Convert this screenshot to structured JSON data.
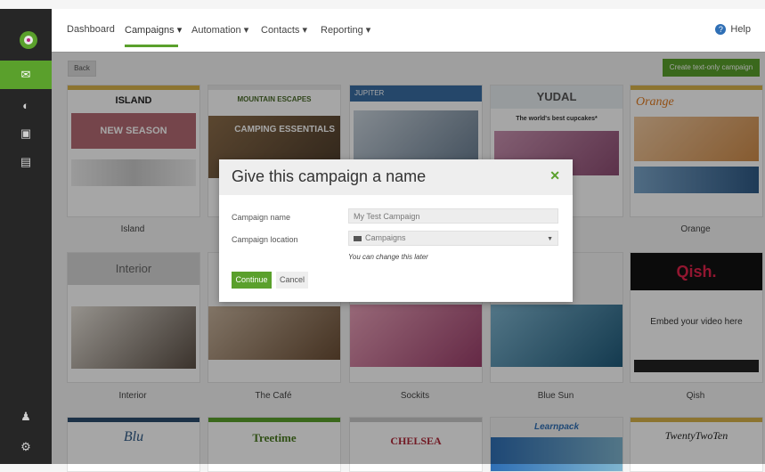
{
  "nav": {
    "items": [
      "Dashboard",
      "Campaigns ▾",
      "Automation ▾",
      "Contacts ▾",
      "Reporting ▾"
    ],
    "help": "Help"
  },
  "toolbar": {
    "back": "Back",
    "create": "Create text-only campaign"
  },
  "templates": [
    {
      "title": "ISLAND",
      "banner": "NEW SEASON",
      "label": "Island"
    },
    {
      "title": "MOUNTAIN ESCAPES",
      "banner": "CAMPING ESSENTIALS",
      "label": ""
    },
    {
      "title": "JUPITER",
      "label": ""
    },
    {
      "title": "YUDAL",
      "subtitle": "The world's best cupcakes*",
      "label": ""
    },
    {
      "title": "Orange",
      "label": "Orange"
    },
    {
      "title": "Interior",
      "label": "Interior"
    },
    {
      "title": "The Café",
      "label": "The Café"
    },
    {
      "title": "Sockits",
      "label": "Sockits"
    },
    {
      "title": "Blue Sun",
      "label": "Blue Sun"
    },
    {
      "title": "Qish.",
      "embed": "Embed your video here",
      "label": "Qish"
    },
    {
      "title": "Blu",
      "label": ""
    },
    {
      "title": "Treetime",
      "label": ""
    },
    {
      "title": "CHELSEA",
      "label": ""
    },
    {
      "title": "Learnpack",
      "label": ""
    },
    {
      "title": "TwentyTwoTen",
      "label": ""
    }
  ],
  "modal": {
    "title": "Give this campaign a name",
    "name_label": "Campaign name",
    "name_value": "My Test Campaign",
    "location_label": "Campaign location",
    "location_value": "Campaigns",
    "hint": "You can change this later",
    "continue": "Continue",
    "cancel": "Cancel"
  },
  "colors": {
    "accent": "#5aa02c",
    "sidebar": "#262626"
  }
}
